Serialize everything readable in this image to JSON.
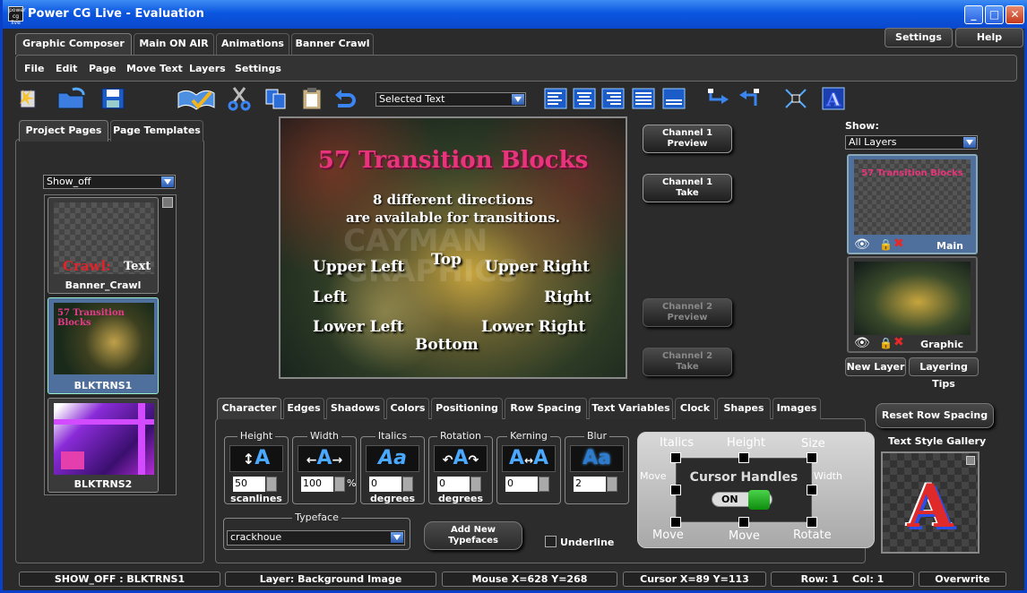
{
  "window": {
    "title": "Power CG Live - Evaluation",
    "icon_text": "power cg live",
    "buttons": [
      "minimize-icon",
      "maximize-icon",
      "close-icon"
    ]
  },
  "top_tabs": [
    "Graphic Composer",
    "Main ON AIR",
    "Animations",
    "Banner Crawl"
  ],
  "top_right": {
    "settings": "Settings",
    "help": "Help"
  },
  "menu": [
    "File",
    "Edit",
    "Page",
    "Move Text",
    "Layers",
    "Settings"
  ],
  "toolbar": {
    "selection_dropdown": "Selected Text"
  },
  "left_panel": {
    "tabs": [
      "Project Pages",
      "Page Templates"
    ],
    "show_dropdown": "Show_off",
    "pages": [
      {
        "label": "Banner_Crawl",
        "preview_text_1": "Crawl:",
        "preview_text_2": "Text"
      },
      {
        "label": "BLKTRNS1",
        "preview_title": "57 Transition Blocks"
      },
      {
        "label": "BLKTRNS2"
      }
    ]
  },
  "preview": {
    "title": "57 Transition Blocks",
    "subtitle_1": "8 different directions",
    "subtitle_2": "are available for transitions.",
    "top": "Top",
    "upper_left": "Upper Left",
    "upper_right": "Upper Right",
    "left": "Left",
    "right": "Right",
    "lower_left": "Lower Left",
    "lower_right": "Lower Right",
    "bottom": "Bottom",
    "watermark": "CAYMAN GRAPHICS"
  },
  "channel_buttons": [
    {
      "line1": "Channel 1",
      "line2": "Preview",
      "enabled": true
    },
    {
      "line1": "Channel 1",
      "line2": "Take",
      "enabled": true
    },
    {
      "line1": "Channel 2",
      "line2": "Preview",
      "enabled": false
    },
    {
      "line1": "Channel 2",
      "line2": "Take",
      "enabled": false
    }
  ],
  "layers": {
    "show_label": "Show:",
    "show_dropdown": "All Layers",
    "items": [
      {
        "label": "Main",
        "selected": true
      },
      {
        "label": "Graphic",
        "selected": false
      }
    ],
    "new_layer": "New Layer",
    "layering_tips": "Layering Tips"
  },
  "style_tabs": [
    "Character",
    "Edges",
    "Shadows",
    "Colors",
    "Positioning",
    "Row Spacing",
    "Text Variables",
    "Clock",
    "Shapes",
    "Images"
  ],
  "character": {
    "groups": [
      {
        "label": "Height",
        "value": "50",
        "unit": "scanlines",
        "suffix": ""
      },
      {
        "label": "Width",
        "value": "100",
        "unit": "",
        "suffix": "%"
      },
      {
        "label": "Italics",
        "value": "0",
        "unit": "degrees",
        "suffix": ""
      },
      {
        "label": "Rotation",
        "value": "0",
        "unit": "degrees",
        "suffix": ""
      },
      {
        "label": "Kerning",
        "value": "0",
        "unit": "",
        "suffix": ""
      },
      {
        "label": "Blur",
        "value": "2",
        "unit": "",
        "suffix": ""
      }
    ],
    "typeface_label": "Typeface",
    "typeface_value": "crackhoue",
    "add_typefaces": "Add New Typefaces",
    "underline": "Underline"
  },
  "cursor_handles": {
    "title": "Cursor Handles",
    "toggle": "ON",
    "labels": {
      "italics": "Italics",
      "height": "Height",
      "size": "Size",
      "move_left": "Move",
      "width": "Width",
      "move_bl": "Move",
      "move_bottom": "Move",
      "rotate": "Rotate"
    }
  },
  "right_bottom": {
    "reset_row_spacing": "Reset Row Spacing",
    "gallery_label": "Text Style Gallery"
  },
  "status_bar": [
    "SHOW_OFF : BLKTRNS1",
    "Layer: Background Image",
    "Mouse X=628 Y=268",
    "Cursor X=89 Y=113",
    "Row: 1    Col: 1",
    "Overwrite"
  ]
}
